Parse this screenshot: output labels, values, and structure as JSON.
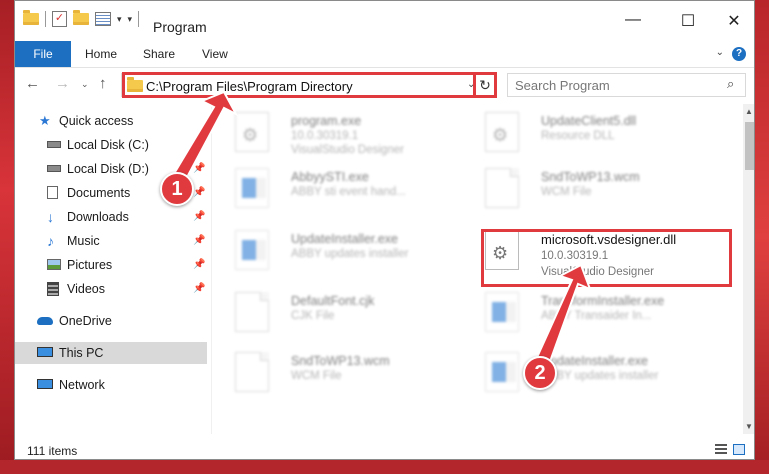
{
  "window": {
    "title": "Program"
  },
  "ribbon": {
    "file": "File",
    "home": "Home",
    "share": "Share",
    "view": "View",
    "help": "?"
  },
  "address": {
    "path": "C:\\Program Files\\Program Directory"
  },
  "search": {
    "placeholder": "Search Program"
  },
  "sidebar": {
    "items": [
      {
        "label": "Quick access",
        "icon": "star-icon"
      },
      {
        "label": "Local Disk (C:)",
        "icon": "drive-icon"
      },
      {
        "label": "Local Disk (D:)",
        "icon": "drive-icon"
      },
      {
        "label": "Documents",
        "icon": "documents-icon"
      },
      {
        "label": "Downloads",
        "icon": "download-icon"
      },
      {
        "label": "Music",
        "icon": "music-icon"
      },
      {
        "label": "Pictures",
        "icon": "pictures-icon"
      },
      {
        "label": "Videos",
        "icon": "videos-icon"
      },
      {
        "label": "OneDrive",
        "icon": "cloud-icon"
      },
      {
        "label": "This PC",
        "icon": "computer-icon"
      },
      {
        "label": "Network",
        "icon": "network-icon"
      }
    ]
  },
  "files": [
    {
      "name": "program.exe",
      "meta1": "10.0.30319.1",
      "meta2": "VisualStudio Designer"
    },
    {
      "name": "UpdateClient5.dll",
      "meta1": "Resource DLL",
      "meta2": ""
    },
    {
      "name": "AbbyySTI.exe",
      "meta1": "ABBY sti event hand...",
      "meta2": ""
    },
    {
      "name": "SndToWP13.wcm",
      "meta1": "WCM File",
      "meta2": ""
    },
    {
      "name": "UpdateInstaller.exe",
      "meta1": "ABBY updates installer",
      "meta2": ""
    },
    {
      "name": "microsoft.vsdesigner.dll",
      "meta1": "10.0.30319.1",
      "meta2": "VisualStudio Designer"
    },
    {
      "name": "DefaultFont.cjk",
      "meta1": "CJK File",
      "meta2": ""
    },
    {
      "name": "TransformInstaller.exe",
      "meta1": "ABBY Transaider In...",
      "meta2": ""
    },
    {
      "name": "SndToWP13.wcm",
      "meta1": "WCM File",
      "meta2": ""
    },
    {
      "name": "UpdateInstaller.exe",
      "meta1": "ABBY updates installer",
      "meta2": ""
    }
  ],
  "status": {
    "count": "111 items"
  },
  "callouts": {
    "one": "1",
    "two": "2"
  },
  "colors": {
    "accent": "#1c6fc1",
    "highlight": "#e03a3f"
  }
}
